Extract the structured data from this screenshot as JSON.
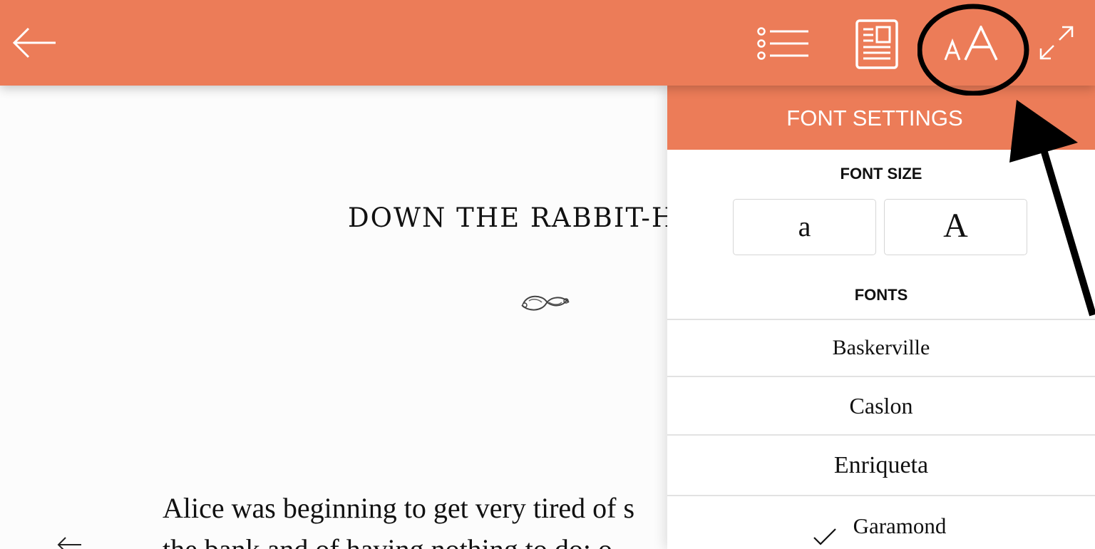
{
  "toolbar": {
    "back_icon": "arrow-left-icon",
    "toc_icon": "list-icon",
    "page_info_icon": "document-icon",
    "font_settings_icon": "font-size-aa-icon",
    "fullscreen_icon": "expand-icon",
    "background_color": "#ec7c58"
  },
  "reader": {
    "chapter_title": "DOWN THE RABBIT-H",
    "ornament_icon": "fleuron-ornament",
    "paragraph_line_1": "Alice was beginning to get very tired of s",
    "paragraph_line_2": "the bank and of having nothing to do: o",
    "prev_icon": "arrow-left-icon"
  },
  "font_settings": {
    "title": "FONT SETTINGS",
    "font_size_label": "FONT SIZE",
    "decrease_label": "a",
    "increase_label": "A",
    "fonts_label": "FONTS",
    "fonts": [
      {
        "label": "Baskerville",
        "selected": false
      },
      {
        "label": "Caslon",
        "selected": false
      },
      {
        "label": "Enriqueta",
        "selected": false
      },
      {
        "label": "Garamond",
        "selected": true
      }
    ],
    "check_icon": "checkmark-icon"
  },
  "annotation": {
    "color": "#000000",
    "shapes": [
      "circle-highlight",
      "pointer-arrow"
    ]
  }
}
